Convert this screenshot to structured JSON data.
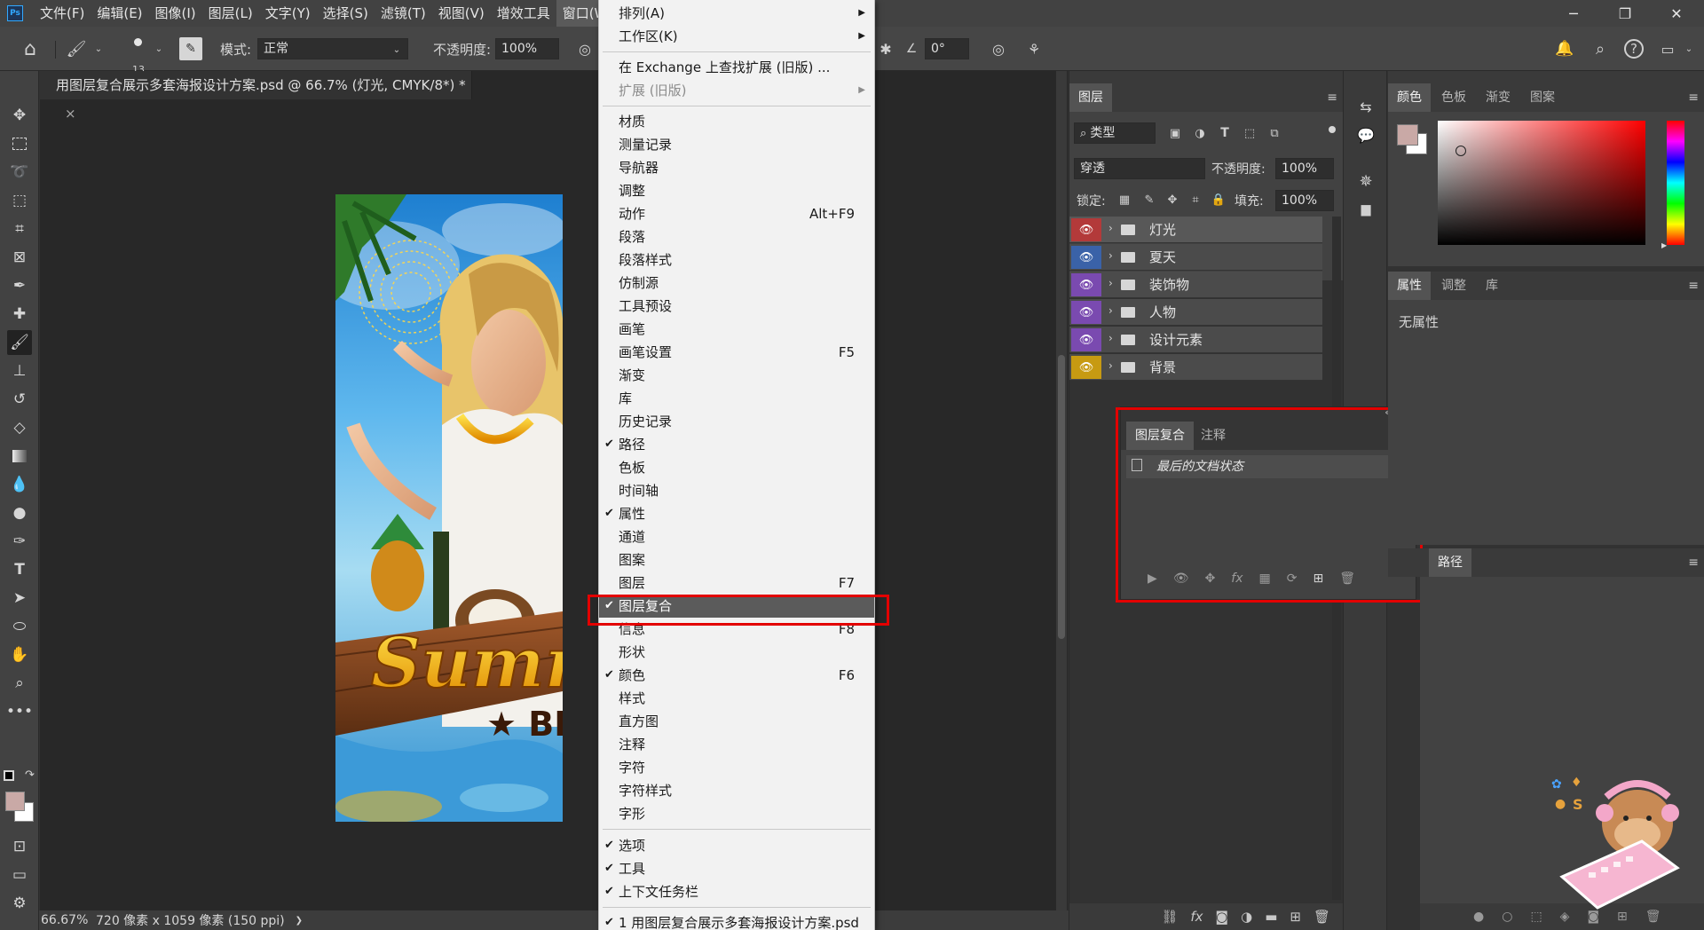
{
  "app": {
    "logo": "Ps"
  },
  "menubar": {
    "items": [
      "文件(F)",
      "编辑(E)",
      "图像(I)",
      "图层(L)",
      "文字(Y)",
      "选择(S)",
      "滤镜(T)",
      "视图(V)",
      "增效工具",
      "窗口(W)"
    ],
    "active": "窗口(W)"
  },
  "window_controls": {
    "minimize": "─",
    "restore": "❐",
    "close": "✕"
  },
  "options_bar": {
    "brush_size": "13",
    "mode_label": "模式:",
    "mode_value": "正常",
    "opacity_label": "不透明度:",
    "opacity_value": "100%",
    "angle_value": "0°"
  },
  "document": {
    "tab_title": "用图层复合展示多套海报设计方案.psd @ 66.7% (灯光, CMYK/8*) *",
    "tab_close": "×",
    "poster_text_1": "Summ",
    "poster_text_2": "★ BR"
  },
  "status_bar": {
    "zoom": "66.67%",
    "doc_info": "720 像素 x 1059 像素 (150 ppi)",
    "arrow": "❯"
  },
  "window_menu": {
    "items": [
      {
        "label": "排列(A)",
        "submenu": true
      },
      {
        "label": "工作区(K)",
        "submenu": true
      },
      {
        "label": "在 Exchange 上查找扩展 (旧版) ..."
      },
      {
        "label": "扩展 (旧版)",
        "submenu": true,
        "disabled": true
      },
      {
        "label": "材质"
      },
      {
        "label": "测量记录"
      },
      {
        "label": "导航器"
      },
      {
        "label": "调整"
      },
      {
        "label": "动作",
        "shortcut": "Alt+F9"
      },
      {
        "label": "段落"
      },
      {
        "label": "段落样式"
      },
      {
        "label": "仿制源"
      },
      {
        "label": "工具预设"
      },
      {
        "label": "画笔"
      },
      {
        "label": "画笔设置",
        "shortcut": "F5"
      },
      {
        "label": "渐变"
      },
      {
        "label": "库"
      },
      {
        "label": "历史记录"
      },
      {
        "label": "路径",
        "checked": true
      },
      {
        "label": "色板"
      },
      {
        "label": "时间轴"
      },
      {
        "label": "属性",
        "checked": true
      },
      {
        "label": "通道"
      },
      {
        "label": "图案"
      },
      {
        "label": "图层",
        "shortcut": "F7"
      },
      {
        "label": "图层复合",
        "checked": true,
        "highlighted": true
      },
      {
        "label": "信息",
        "shortcut": "F8"
      },
      {
        "label": "形状"
      },
      {
        "label": "颜色",
        "checked": true,
        "shortcut": "F6"
      },
      {
        "label": "样式"
      },
      {
        "label": "直方图"
      },
      {
        "label": "注释"
      },
      {
        "label": "字符"
      },
      {
        "label": "字符样式"
      },
      {
        "label": "字形"
      },
      {
        "label": "选项",
        "checked": true
      },
      {
        "label": "工具",
        "checked": true
      },
      {
        "label": "上下文任务栏",
        "checked": true
      },
      {
        "label": "1 用图层复合展示多套海报设计方案.psd",
        "checked": true
      }
    ],
    "check_mark": "✔",
    "arrow_mark": "▶"
  },
  "layers_panel": {
    "tab": "图层",
    "filter_label": "类型",
    "blend_mode": "穿透",
    "opacity_label": "不透明度:",
    "opacity_value": "100%",
    "lock_label": "锁定:",
    "fill_label": "填充:",
    "fill_value": "100%",
    "layers": [
      {
        "name": "灯光",
        "color": "#b33a3a"
      },
      {
        "name": "夏天",
        "color": "#3a62a8"
      },
      {
        "name": "装饰物",
        "color": "#7a4ab0"
      },
      {
        "name": "人物",
        "color": "#7a4ab0"
      },
      {
        "name": "设计元素",
        "color": "#7a4ab0"
      },
      {
        "name": "背景",
        "color": "#c79a12"
      }
    ]
  },
  "layer_comps_panel": {
    "tabs": [
      "图层复合",
      "注释"
    ],
    "last_state": "最后的文档状态",
    "collapse": "«",
    "close": "✕"
  },
  "color_panel": {
    "tabs": [
      "颜色",
      "色板",
      "渐变",
      "图案"
    ],
    "foreground": "#c9a9a6",
    "background": "#ffffff"
  },
  "properties_panel": {
    "tabs": [
      "属性",
      "调整",
      "库"
    ],
    "empty_text": "无属性"
  },
  "paths_panel": {
    "tab": "路径"
  },
  "colors": {
    "highlight_box": "#e30000",
    "menu_bg": "#f2f2f2",
    "menu_highlight": "#5b5b5b"
  }
}
